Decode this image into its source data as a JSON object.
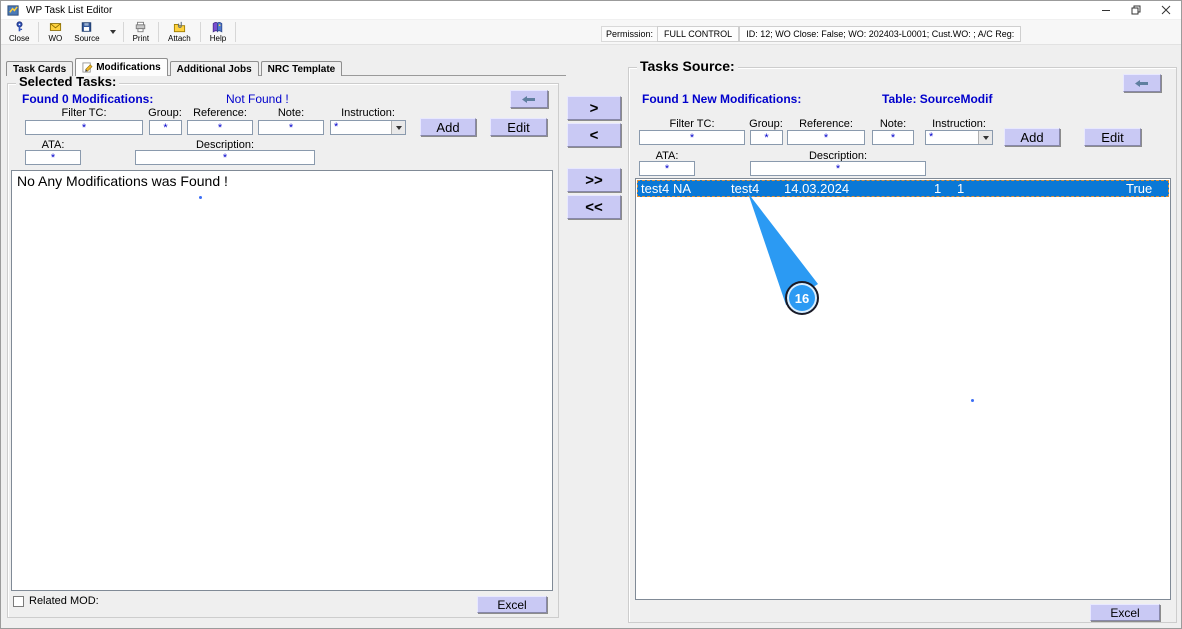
{
  "window": {
    "title": "WP Task List Editor",
    "controls": [
      "minimize-icon",
      "restore-icon",
      "close-icon"
    ]
  },
  "toolbar": {
    "buttons": [
      {
        "label": "Close",
        "icon": "exit-door-icon"
      },
      {
        "label": "WO",
        "icon": "work-order-envelope-icon"
      },
      {
        "label": "Source",
        "icon": "source-disk-icon",
        "dropdown": true
      },
      {
        "label": "Print",
        "icon": "printer-icon"
      },
      {
        "label": "Attach",
        "icon": "attach-folder-icon"
      },
      {
        "label": "Help",
        "icon": "help-book-icon"
      }
    ]
  },
  "status": {
    "permission_label": "Permission:",
    "permission_value": "FULL CONTROL",
    "wo_info": "ID: 12; WO Close: False; WO: 202403-L0001; Cust.WO: ; A/C Reg:"
  },
  "tabs": {
    "task_cards": "Task Cards",
    "modifications": "Modifications",
    "additional_jobs": "Additional Jobs",
    "nrc_template": "NRC Template"
  },
  "left_panel": {
    "title": "Selected Tasks:",
    "found_text": "Found 0 Modifications:",
    "not_found_text": "Not Found !",
    "labels": {
      "filter_tc": "Filter TC:",
      "group": "Group:",
      "reference": "Reference:",
      "note": "Note:",
      "instruction": "Instruction:",
      "ata": "ATA:",
      "description": "Description:"
    },
    "wildcard": "*",
    "buttons": {
      "add": "Add",
      "edit": "Edit",
      "excel": "Excel"
    },
    "empty_text": "No Any Modifications was Found !",
    "related_mod_label": "Related MOD:"
  },
  "transfer": {
    "right": ">",
    "left": "<",
    "all_right": ">>",
    "all_left": "<<"
  },
  "right_panel": {
    "title": "Tasks Source:",
    "found_text": "Found 1 New Modifications:",
    "table_text": "Table: SourceModif",
    "labels": {
      "filter_tc": "Filter TC:",
      "group": "Group:",
      "reference": "Reference:",
      "note": "Note:",
      "instruction": "Instruction:",
      "ata": "ATA:",
      "description": "Description:"
    },
    "wildcard": "*",
    "buttons": {
      "add": "Add",
      "edit": "Edit",
      "excel": "Excel"
    },
    "row": {
      "ata": "test4",
      "group": "NA",
      "reference": "test4",
      "date": "14.03.2024",
      "rev": "1",
      "count": "1",
      "active": "True"
    }
  },
  "annotation": {
    "step_number": "16"
  },
  "colors": {
    "button_accent": "#c9c9f4",
    "selection_blue": "#0a78d6",
    "text_blue": "#0000cc",
    "callout_blue": "#2b9af3",
    "focus_dash_orange": "#e09035"
  }
}
